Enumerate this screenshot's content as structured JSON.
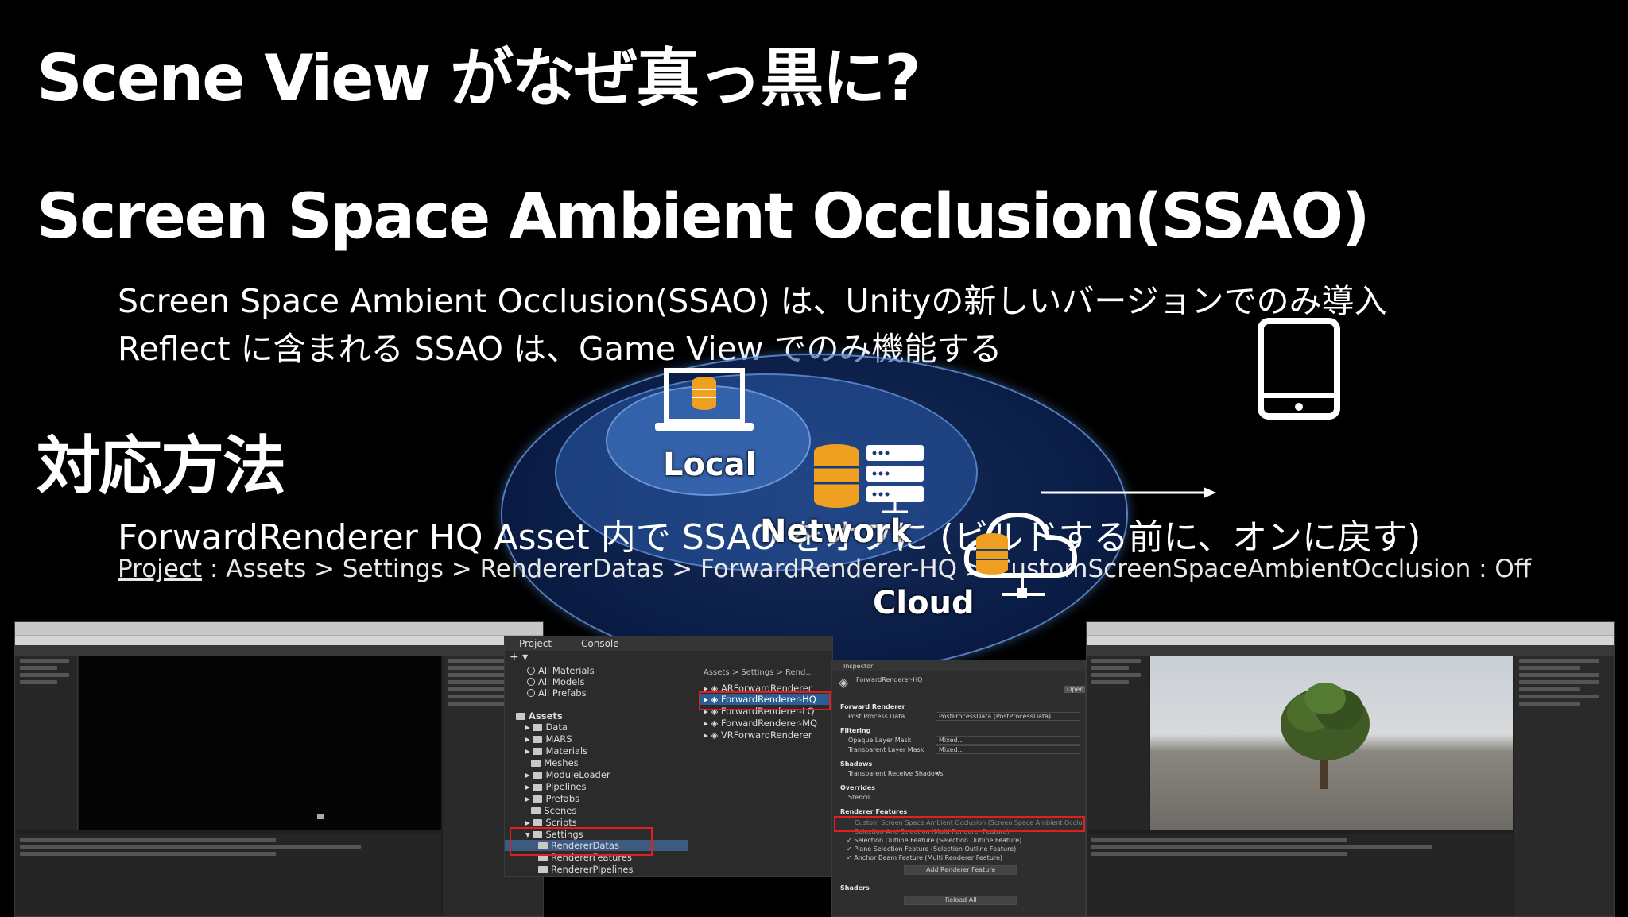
{
  "slide": {
    "heading1": "Scene View がなぜ真っ黒に?",
    "heading2": "Screen Space Ambient Occlusion(SSAO)",
    "bullet1": "Screen Space Ambient Occlusion(SSAO) は、Unityの新しいバージョンでのみ導入",
    "bullet2": "Reflect に含まれる SSAO は、Game View でのみ機能する",
    "heading3": "対応方法",
    "solution": "ForwardRenderer HQ Asset 内で SSAO をオフに (ビルドする前に、オンに戻す)",
    "path_link": "Project",
    "path_rest": " : Assets > Settings > RendererDatas > ForwardRenderer-HQ > CustomScreenSpaceAmbientOcclusion : Off"
  },
  "network_overlay": {
    "local_label": "Local",
    "network_label": "Network",
    "cloud_label": "Cloud"
  },
  "project_panel": {
    "tabs": [
      "Project",
      "Console"
    ],
    "search_items": [
      "All Materials",
      "All Models",
      "All Prefabs"
    ],
    "assets_root": "Assets",
    "folders": [
      "Data",
      "MARS",
      "Materials",
      "Meshes",
      "ModuleLoader",
      "Pipelines",
      "Prefabs",
      "Scenes",
      "Scripts",
      "Settings"
    ],
    "settings_children": [
      "RendererDatas",
      "RendererFeatures",
      "RendererPipelines"
    ],
    "breadcrumb": "Assets > Settings > Rend...",
    "asset_files": [
      "ARForwardRenderer",
      "ForwardRenderer-HQ",
      "ForwardRenderer-LQ",
      "ForwardRenderer-MQ",
      "VRForwardRenderer"
    ]
  },
  "inspector": {
    "tab": "Inspector",
    "object_name": "ForwardRenderer-HQ",
    "open_button": "Open",
    "section_forward": "Forward Renderer",
    "post_process_label": "Post Process Data",
    "post_process_value": "PostProcessData (PostProcessData)",
    "section_filtering": "Filtering",
    "opaque_label": "Opaque Layer Mask",
    "opaque_value": "Mixed...",
    "transparent_label": "Transparent Layer Mask",
    "transparent_value": "Mixed...",
    "section_shadows": "Shadows",
    "shadows_label": "Transparent Receive Shadows",
    "section_overrides": "Overrides",
    "stencil_label": "Stencil",
    "section_features": "Renderer Features",
    "features": [
      "Custom Screen Space Ambient Occlusion (Screen Space Ambient Occlu",
      "Selection And Selection (Multi Renderer Feature)",
      "Selection Outline Feature (Selection Outline Feature)",
      "Plane Selection Feature (Selection Outline Feature)",
      "Anchor Beam Feature (Multi Renderer Feature)"
    ],
    "add_feature_button": "Add Renderer Feature",
    "section_shaders": "Shaders",
    "reload_button": "Reload All"
  },
  "colors": {
    "background": "#000000",
    "highlight_red": "#e02020",
    "ellipse_blue": "#1e4fa0"
  }
}
